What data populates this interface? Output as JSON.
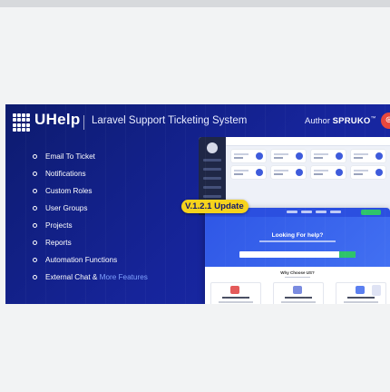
{
  "banner": {
    "brand": "UHelp",
    "subtitle": "Laravel Support Ticketing System",
    "author_prefix": "Author",
    "author_name": "SPRUKO",
    "author_tm": "™",
    "update_badge": "V.1.2.1 Update",
    "features": [
      "Email To Ticket",
      "Notifications",
      "Custom Roles",
      "User Groups",
      "Projects",
      "Reports",
      "Automation Functions",
      "External Chat &"
    ],
    "more_features": "More Features"
  },
  "preview": {
    "help_title": "Looking For help?",
    "why_title": "Why Choose US?"
  },
  "colors": {
    "banner": "#16249a",
    "badge": "#f6d31c",
    "accent": "#2b4fe0",
    "author_icon": "#e8473c"
  }
}
